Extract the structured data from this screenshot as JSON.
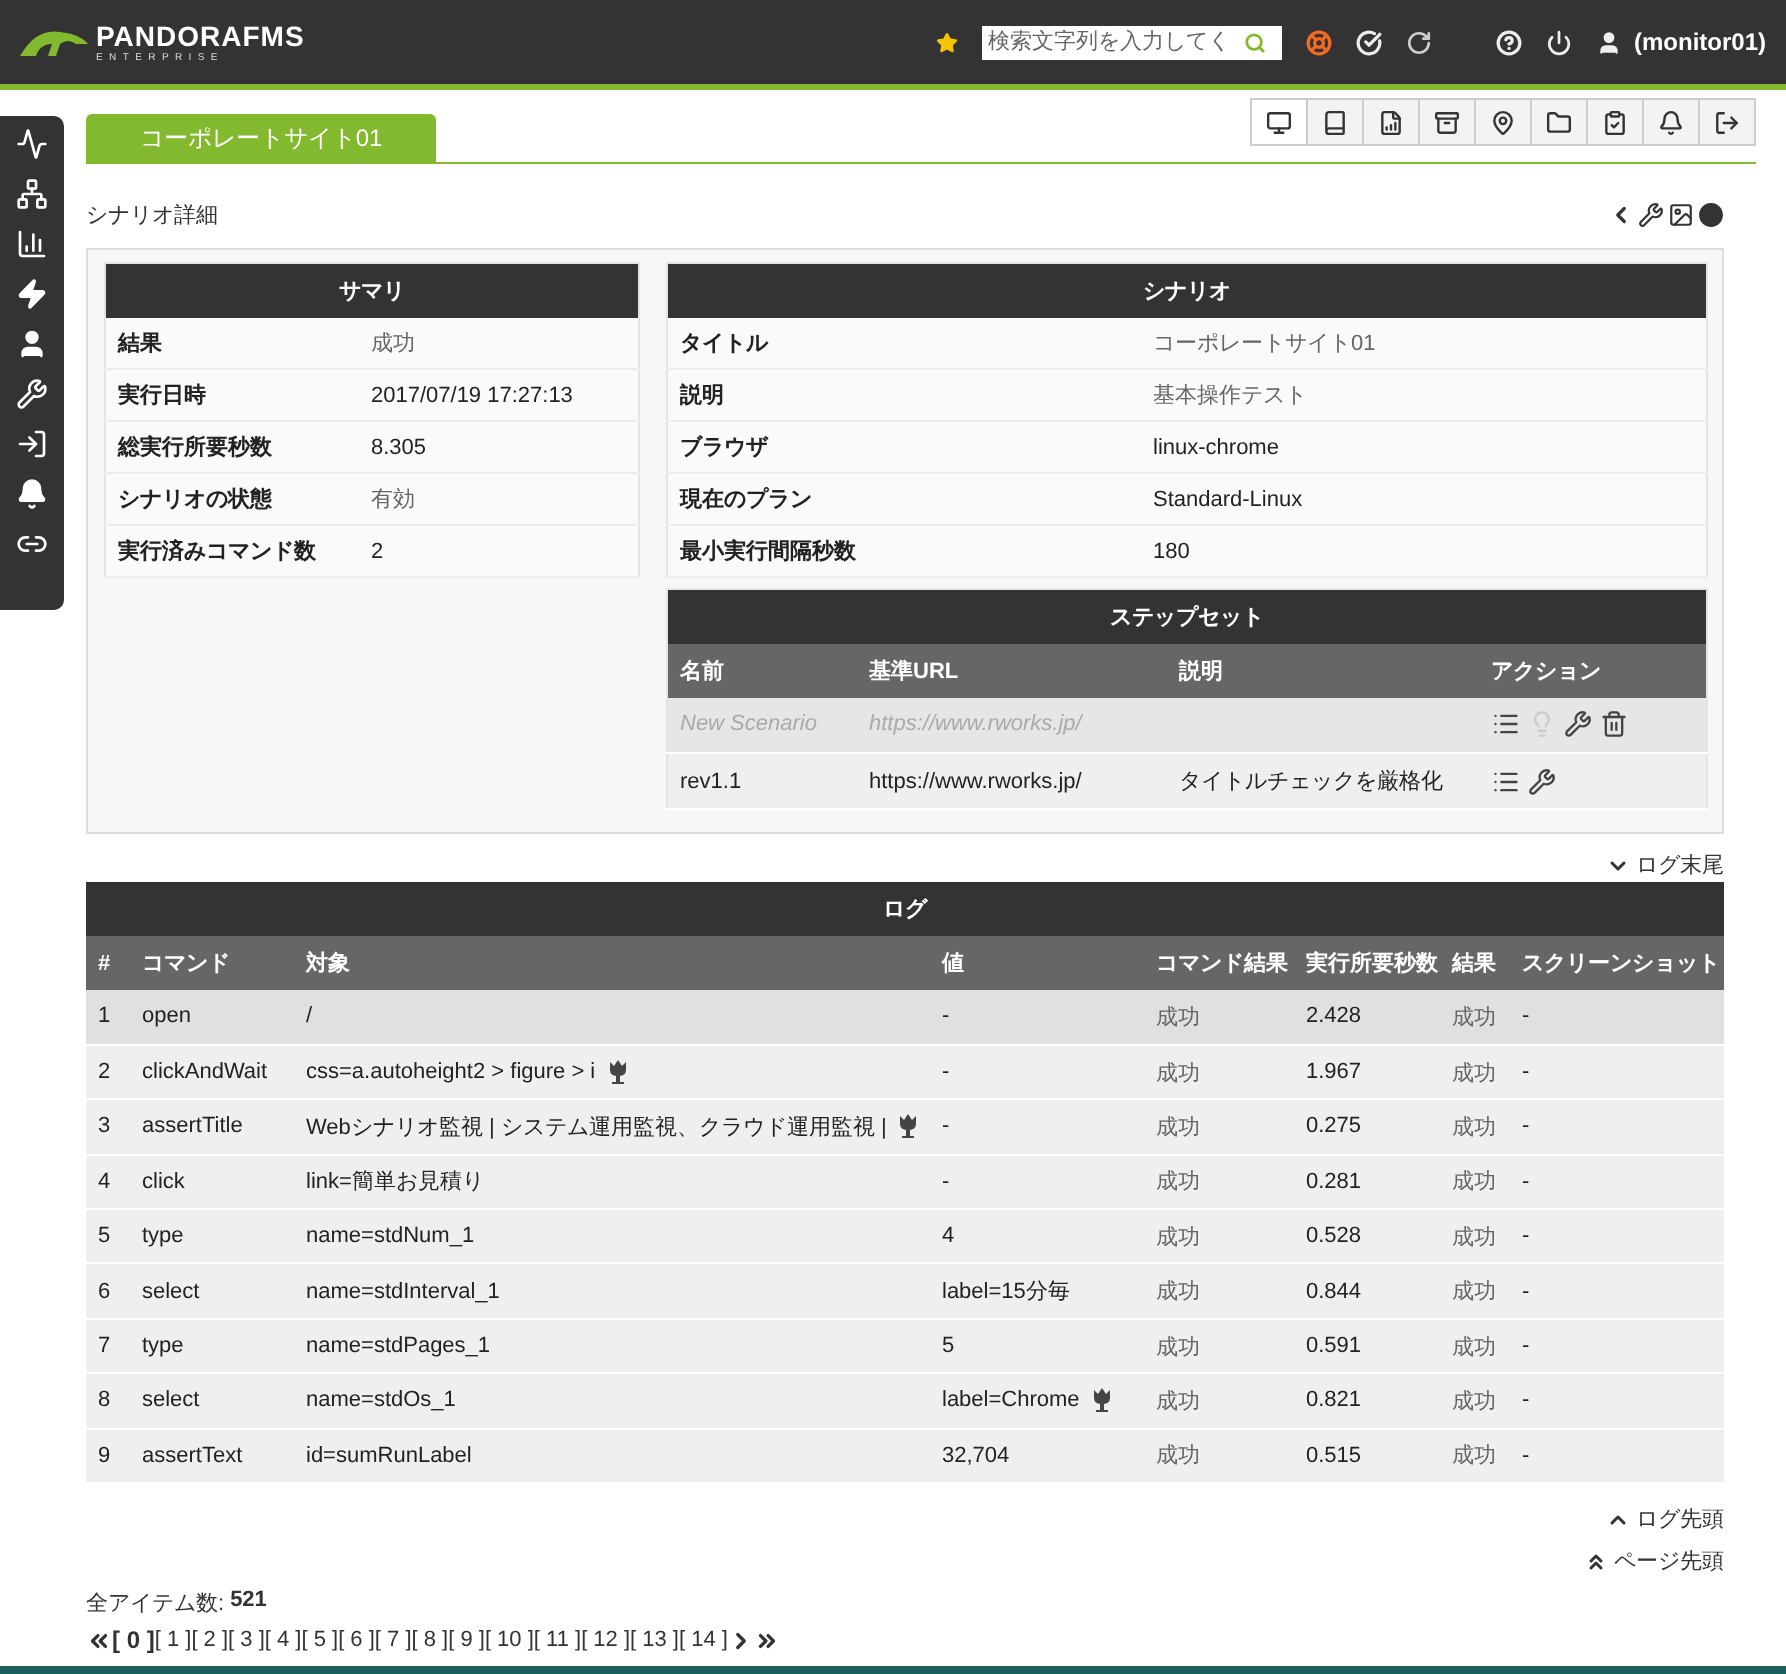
{
  "header": {
    "logo": "PANDORAFMS",
    "logo_sub": "ENTERPRISE",
    "search": {
      "placeholder": "検索文字列を入力してく"
    },
    "user": "(monitor01)"
  },
  "tabs": [
    {
      "label": "コーポレートサイト01",
      "selected": true
    }
  ],
  "icon_tabs": [
    {
      "kind": "monitor",
      "selected": true
    },
    {
      "kind": "book",
      "selected": false
    },
    {
      "kind": "chart",
      "selected": false
    },
    {
      "kind": "archive",
      "selected": false
    },
    {
      "kind": "pin",
      "selected": false
    },
    {
      "kind": "folder",
      "selected": false
    },
    {
      "kind": "clipboard",
      "selected": false
    },
    {
      "kind": "bell",
      "selected": false
    },
    {
      "kind": "logout",
      "selected": false
    }
  ],
  "section_title": "シナリオ詳細",
  "summary": {
    "title": "サマリ",
    "rows": [
      {
        "label": "結果",
        "value": "成功",
        "muted": true
      },
      {
        "label": "実行日時",
        "value": "2017/07/19 17:27:13",
        "muted": false
      },
      {
        "label": "総実行所要秒数",
        "value": "8.305",
        "muted": false
      },
      {
        "label": "シナリオの状態",
        "value": "有効",
        "muted": true
      },
      {
        "label": "実行済みコマンド数",
        "value": "2",
        "muted": false
      }
    ]
  },
  "scenario": {
    "title": "シナリオ",
    "rows": [
      {
        "label": "タイトル",
        "value": "コーポレートサイト01",
        "muted": true
      },
      {
        "label": "説明",
        "value": "基本操作テスト",
        "muted": true
      },
      {
        "label": "ブラウザ",
        "value": "linux-chrome",
        "muted": false
      },
      {
        "label": "現在のプラン",
        "value": "Standard-Linux",
        "muted": false
      },
      {
        "label": "最小実行間隔秒数",
        "value": "180",
        "muted": false
      }
    ]
  },
  "step_set": {
    "title": "ステップセット",
    "columns": [
      "名前",
      "基準URL",
      "説明",
      "アクション"
    ],
    "rows": [
      {
        "name": "New Scenario",
        "url": "https://www.rworks.jp/",
        "description": "",
        "disabled": true,
        "actions": [
          {
            "kind": "list"
          },
          {
            "kind": "bulb"
          },
          {
            "kind": "wrench"
          },
          {
            "kind": "trash"
          }
        ]
      },
      {
        "name": "rev1.1",
        "url": "https://www.rworks.jp/",
        "description": "タイトルチェックを厳格化",
        "disabled": false,
        "actions": [
          {
            "kind": "list"
          },
          {
            "kind": "wrench"
          }
        ]
      }
    ]
  },
  "log_end_link": "ログ末尾",
  "log": {
    "title": "ログ",
    "columns": [
      "#",
      "コマンド",
      "対象",
      "値",
      "コマンド結果",
      "実行所要秒数",
      "結果",
      "スクリーンショット"
    ],
    "rows": [
      {
        "num": "1",
        "command": "open",
        "target": "/",
        "target_image": false,
        "value": "-",
        "value_image": false,
        "cmd_result": "成功",
        "duration": "2.428",
        "result": "成功",
        "screenshot": "-",
        "selected": true
      },
      {
        "num": "2",
        "command": "clickAndWait",
        "target": "css=a.autoheight2 > figure > i",
        "target_image": true,
        "value": "-",
        "value_image": false,
        "cmd_result": "成功",
        "duration": "1.967",
        "result": "成功",
        "screenshot": "-",
        "selected": false
      },
      {
        "num": "3",
        "command": "assertTitle",
        "target": "Webシナリオ監視 | システム運用監視、クラウド運用監視 |",
        "target_image": true,
        "value": "-",
        "value_image": false,
        "cmd_result": "成功",
        "duration": "0.275",
        "result": "成功",
        "screenshot": "-",
        "selected": false
      },
      {
        "num": "4",
        "command": "click",
        "target": "link=簡単お見積り",
        "target_image": false,
        "value": "-",
        "value_image": false,
        "cmd_result": "成功",
        "duration": "0.281",
        "result": "成功",
        "screenshot": "-",
        "selected": false
      },
      {
        "num": "5",
        "command": "type",
        "target": "name=stdNum_1",
        "target_image": false,
        "value": "4",
        "value_image": false,
        "cmd_result": "成功",
        "duration": "0.528",
        "result": "成功",
        "screenshot": "-",
        "selected": false
      },
      {
        "num": "6",
        "command": "select",
        "target": "name=stdInterval_1",
        "target_image": false,
        "value": "label=15分毎",
        "value_image": false,
        "cmd_result": "成功",
        "duration": "0.844",
        "result": "成功",
        "screenshot": "-",
        "selected": false
      },
      {
        "num": "7",
        "command": "type",
        "target": "name=stdPages_1",
        "target_image": false,
        "value": "5",
        "value_image": false,
        "cmd_result": "成功",
        "duration": "0.591",
        "result": "成功",
        "screenshot": "-",
        "selected": false
      },
      {
        "num": "8",
        "command": "select",
        "target": "name=stdOs_1",
        "target_image": false,
        "value": "label=Chrome",
        "value_image": true,
        "cmd_result": "成功",
        "duration": "0.821",
        "result": "成功",
        "screenshot": "-",
        "selected": false
      },
      {
        "num": "9",
        "command": "assertText",
        "target": "id=sumRunLabel",
        "target_image": false,
        "value": "32,704",
        "value_image": false,
        "cmd_result": "成功",
        "duration": "0.515",
        "result": "成功",
        "screenshot": "-",
        "selected": false
      }
    ]
  },
  "log_top_link": "ログ先頭",
  "page_top_link": "ページ先頭",
  "total": {
    "label": "全アイテム数:",
    "value": "521"
  },
  "pages": [
    {
      "label": "[ 0 ]",
      "selected": true
    },
    {
      "label": "[ 1 ]",
      "selected": false
    },
    {
      "label": "[ 2 ]",
      "selected": false
    },
    {
      "label": "[ 3 ]",
      "selected": false
    },
    {
      "label": "[ 4 ]",
      "selected": false
    },
    {
      "label": "[ 5 ]",
      "selected": false
    },
    {
      "label": "[ 6 ]",
      "selected": false
    },
    {
      "label": "[ 7 ]",
      "selected": false
    },
    {
      "label": "[ 8 ]",
      "selected": false
    },
    {
      "label": "[ 9 ]",
      "selected": false
    },
    {
      "label": "[ 10 ]",
      "selected": false
    },
    {
      "label": "[ 11 ]",
      "selected": false
    },
    {
      "label": "[ 12 ]",
      "selected": false
    },
    {
      "label": "[ 13 ]",
      "selected": false
    },
    {
      "label": "[ 14 ]",
      "selected": false
    }
  ]
}
